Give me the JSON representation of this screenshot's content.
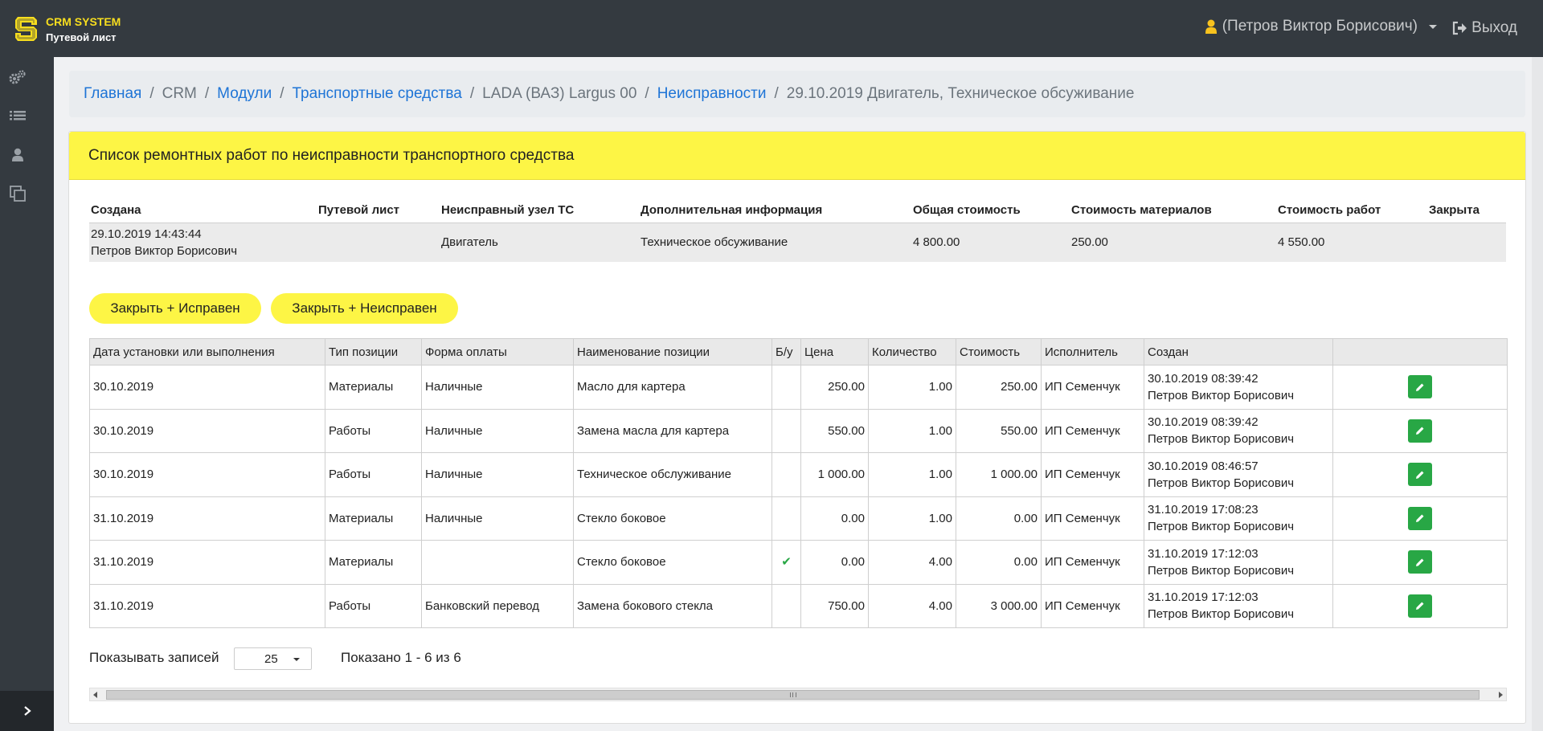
{
  "header": {
    "brand_title": "CRM SYSTEM",
    "brand_subtitle": "Путевой лист",
    "user_name": "(Петров Виктор Борисович)",
    "logout_label": "Выход"
  },
  "sidebar": {
    "items": [
      {
        "icon": "gears-icon"
      },
      {
        "icon": "list-icon"
      },
      {
        "icon": "user-icon"
      },
      {
        "icon": "copy-icon"
      }
    ],
    "toggle_icon": "chevron-right-icon"
  },
  "breadcrumb": {
    "items": [
      {
        "label": "Главная",
        "link": true
      },
      {
        "label": "CRM",
        "link": false
      },
      {
        "label": "Модули",
        "link": true
      },
      {
        "label": "Транспортные средства",
        "link": true
      },
      {
        "label": "LADA (ВАЗ) Largus 00",
        "link": false
      },
      {
        "label": "Неисправности",
        "link": true
      },
      {
        "label": "29.10.2019 Двигатель, Техническое обсуживание",
        "link": false
      }
    ],
    "separator": "/"
  },
  "card": {
    "title": "Список ремонтных работ по неисправности транспортного средства"
  },
  "summary": {
    "headers": [
      "Создана",
      "Путевой лист",
      "Неисправный узел ТС",
      "Дополнительная информация",
      "Общая стоимость",
      "Стоимость материалов",
      "Стоимость работ",
      "Закрыта"
    ],
    "row": {
      "created_date": "29.10.2019 14:43:44",
      "created_by": "Петров Виктор Борисович",
      "waybill": "",
      "unit": "Двигатель",
      "info": "Техническое обсуживание",
      "total": "4 800.00",
      "materials": "250.00",
      "works": "4 550.00",
      "closed": ""
    }
  },
  "actions": {
    "close_ok": "Закрыть + Исправен",
    "close_faulty": "Закрыть + Неисправен"
  },
  "table": {
    "headers": [
      "Дата установки или выполнения",
      "Тип позиции",
      "Форма оплаты",
      "Наименование позиции",
      "Б/у",
      "Цена",
      "Количество",
      "Стоимость",
      "Исполнитель",
      "Создан",
      ""
    ],
    "rows": [
      {
        "date": "30.10.2019",
        "type": "Материалы",
        "payment": "Наличные",
        "name": "Масло для картера",
        "used": "",
        "price": "250.00",
        "qty": "1.00",
        "cost": "250.00",
        "executor": "ИП Семенчук",
        "created_at": "30.10.2019 08:39:42",
        "created_by": "Петров Виктор Борисович"
      },
      {
        "date": "30.10.2019",
        "type": "Работы",
        "payment": "Наличные",
        "name": "Замена масла для картера",
        "used": "",
        "price": "550.00",
        "qty": "1.00",
        "cost": "550.00",
        "executor": "ИП Семенчук",
        "created_at": "30.10.2019 08:39:42",
        "created_by": "Петров Виктор Борисович"
      },
      {
        "date": "30.10.2019",
        "type": "Работы",
        "payment": "Наличные",
        "name": "Техническое обслуживание",
        "used": "",
        "price": "1 000.00",
        "qty": "1.00",
        "cost": "1 000.00",
        "executor": "ИП Семенчук",
        "created_at": "30.10.2019 08:46:57",
        "created_by": "Петров Виктор Борисович"
      },
      {
        "date": "31.10.2019",
        "type": "Материалы",
        "payment": "Наличные",
        "name": "Стекло боковое",
        "used": "",
        "price": "0.00",
        "qty": "1.00",
        "cost": "0.00",
        "executor": "ИП Семенчук",
        "created_at": "31.10.2019 17:08:23",
        "created_by": "Петров Виктор Борисович"
      },
      {
        "date": "31.10.2019",
        "type": "Материалы",
        "payment": "",
        "name": "Стекло боковое",
        "used": "✔",
        "price": "0.00",
        "qty": "4.00",
        "cost": "0.00",
        "executor": "ИП Семенчук",
        "created_at": "31.10.2019 17:12:03",
        "created_by": "Петров Виктор Борисович"
      },
      {
        "date": "31.10.2019",
        "type": "Работы",
        "payment": "Банковский перевод",
        "name": "Замена бокового стекла",
        "used": "",
        "price": "750.00",
        "qty": "4.00",
        "cost": "3 000.00",
        "executor": "ИП Семенчук",
        "created_at": "31.10.2019 17:12:03",
        "created_by": "Петров Виктор Борисович"
      }
    ]
  },
  "pagination": {
    "show_label": "Показывать записей",
    "page_size": "25",
    "info": "Показано 1 - 6 из 6"
  },
  "colors": {
    "header_bg": "#343a40",
    "accent_yellow": "#fdf545",
    "link_blue": "#1e74d6",
    "edit_green": "#28a745"
  }
}
